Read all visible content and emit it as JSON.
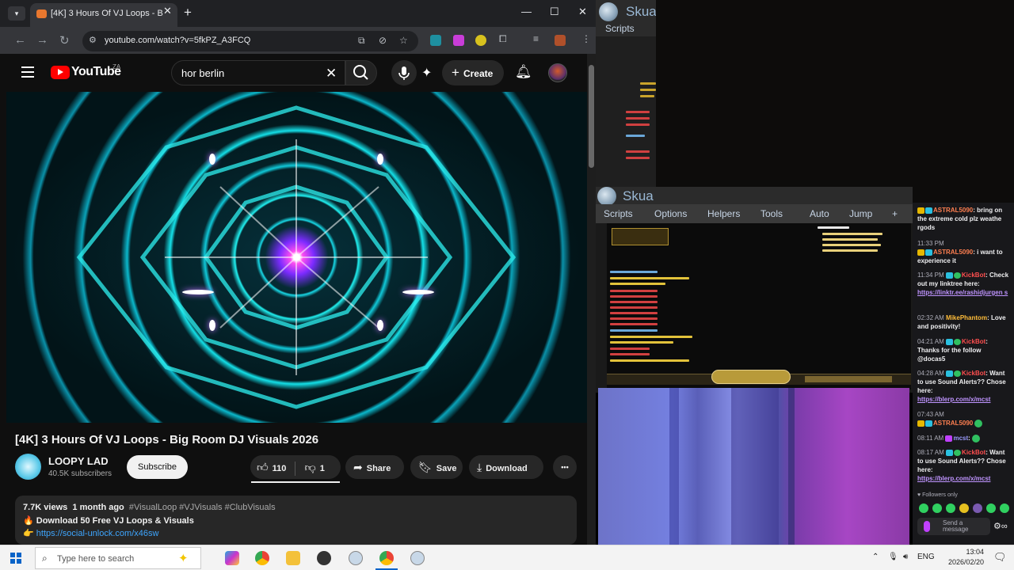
{
  "browser": {
    "tab_title": "[4K] 3 Hours Of VJ Loops - B",
    "url": "youtube.com/watch?v=5fkPZ_A3FCQ"
  },
  "youtube": {
    "logo_text": "YouTube",
    "country_code": "ZA",
    "search_query": "hor berlin",
    "create_label": "Create",
    "video_title": "[4K] 3 Hours Of VJ Loops - Big Room DJ Visuals 2026",
    "channel_name": "LOOPY LAD",
    "subscribers": "40.5K subscribers",
    "subscribe_label": "Subscribe",
    "likes": "110",
    "dislikes": "1",
    "share_label": "Share",
    "save_label": "Save",
    "download_label": "Download",
    "more_label": "•••",
    "description": {
      "views": "7.7K views",
      "age": "1 month ago",
      "tags": "#VisualLoop #VJVisuals #ClubVisuals",
      "line2": "🔥 Download 50 Free VJ Loops & Visuals",
      "link": "https://social-unlock.com/x46sw"
    }
  },
  "skua": {
    "app_name": "Skua",
    "menu": [
      "Scripts",
      "Options",
      "Helpers",
      "Tools",
      "Auto",
      "Jump",
      "+"
    ],
    "scripts_label": "Scripts"
  },
  "chat": {
    "messages": [
      {
        "time": "",
        "user": "ASTRAL5090",
        "text": ": bring on the extreme cold plz weathe rgods",
        "color": "n1"
      },
      {
        "time": "11:33 PM",
        "user": "ASTRAL5090",
        "text": ": i want to experience it",
        "color": "n1"
      },
      {
        "time": "11:34 PM",
        "user": "KickBot",
        "text": ": Check out my linktree here:",
        "link": "https://linktr.ee/rashidjurgen s",
        "color": "n2"
      },
      {
        "time": "02:32 AM",
        "user": "MikePhantom",
        "text": ": Love and positivity!",
        "color": "n4"
      },
      {
        "time": "04:21 AM",
        "user": "KickBot",
        "text": ": Thanks for the follow @docas5",
        "color": "n2"
      },
      {
        "time": "04:28 AM",
        "user": "KickBot",
        "text": ": Want to use Sound Alerts?? Chose here:",
        "link": "https://blerp.com/x/mcst",
        "color": "n2"
      },
      {
        "time": "07:43 AM",
        "user": "ASTRAL5090",
        "text": "",
        "color": "n1"
      },
      {
        "time": "08:11 AM",
        "user": "mcst",
        "text": ":",
        "color": "n3"
      },
      {
        "time": "08:17 AM",
        "user": "KickBot",
        "text": ": Want to use Sound Alerts?? Chose here:",
        "link": "https://blerp.com/x/mcst",
        "color": "n2"
      }
    ],
    "followers_only": "Followers only",
    "input_placeholder": "Send a message"
  },
  "taskbar": {
    "search_placeholder": "Type here to search",
    "language": "ENG",
    "time": "13:04",
    "date": "2026/02/20"
  }
}
